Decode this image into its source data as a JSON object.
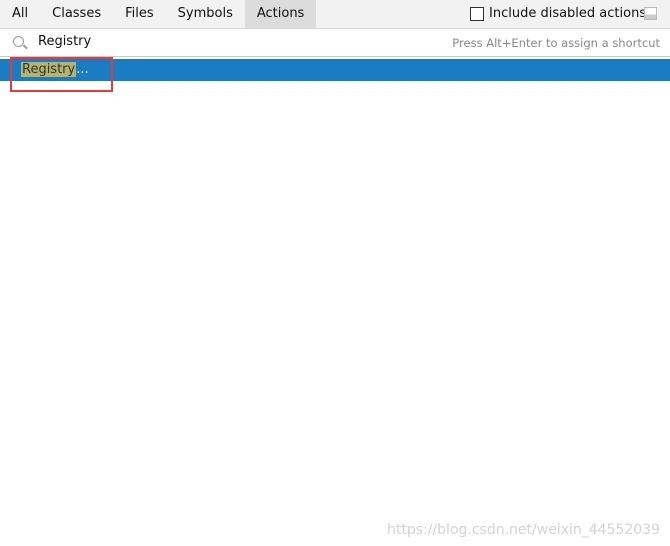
{
  "tabs": [
    "All",
    "Classes",
    "Files",
    "Symbols",
    "Actions"
  ],
  "active_tab": "Actions",
  "include_disabled": {
    "label": "Include disabled actions",
    "checked": false
  },
  "search": {
    "value": "Registry",
    "hint": "Press Alt+Enter to assign a shortcut"
  },
  "results": [
    {
      "match": "Registry",
      "suffix": "...",
      "selected": true
    }
  ],
  "watermark": "https://blog.csdn.net/weixin_44552039",
  "colors": {
    "selection": "#1a7dc4",
    "highlight": "#b4b46e",
    "annotation": "#e83a3a"
  }
}
